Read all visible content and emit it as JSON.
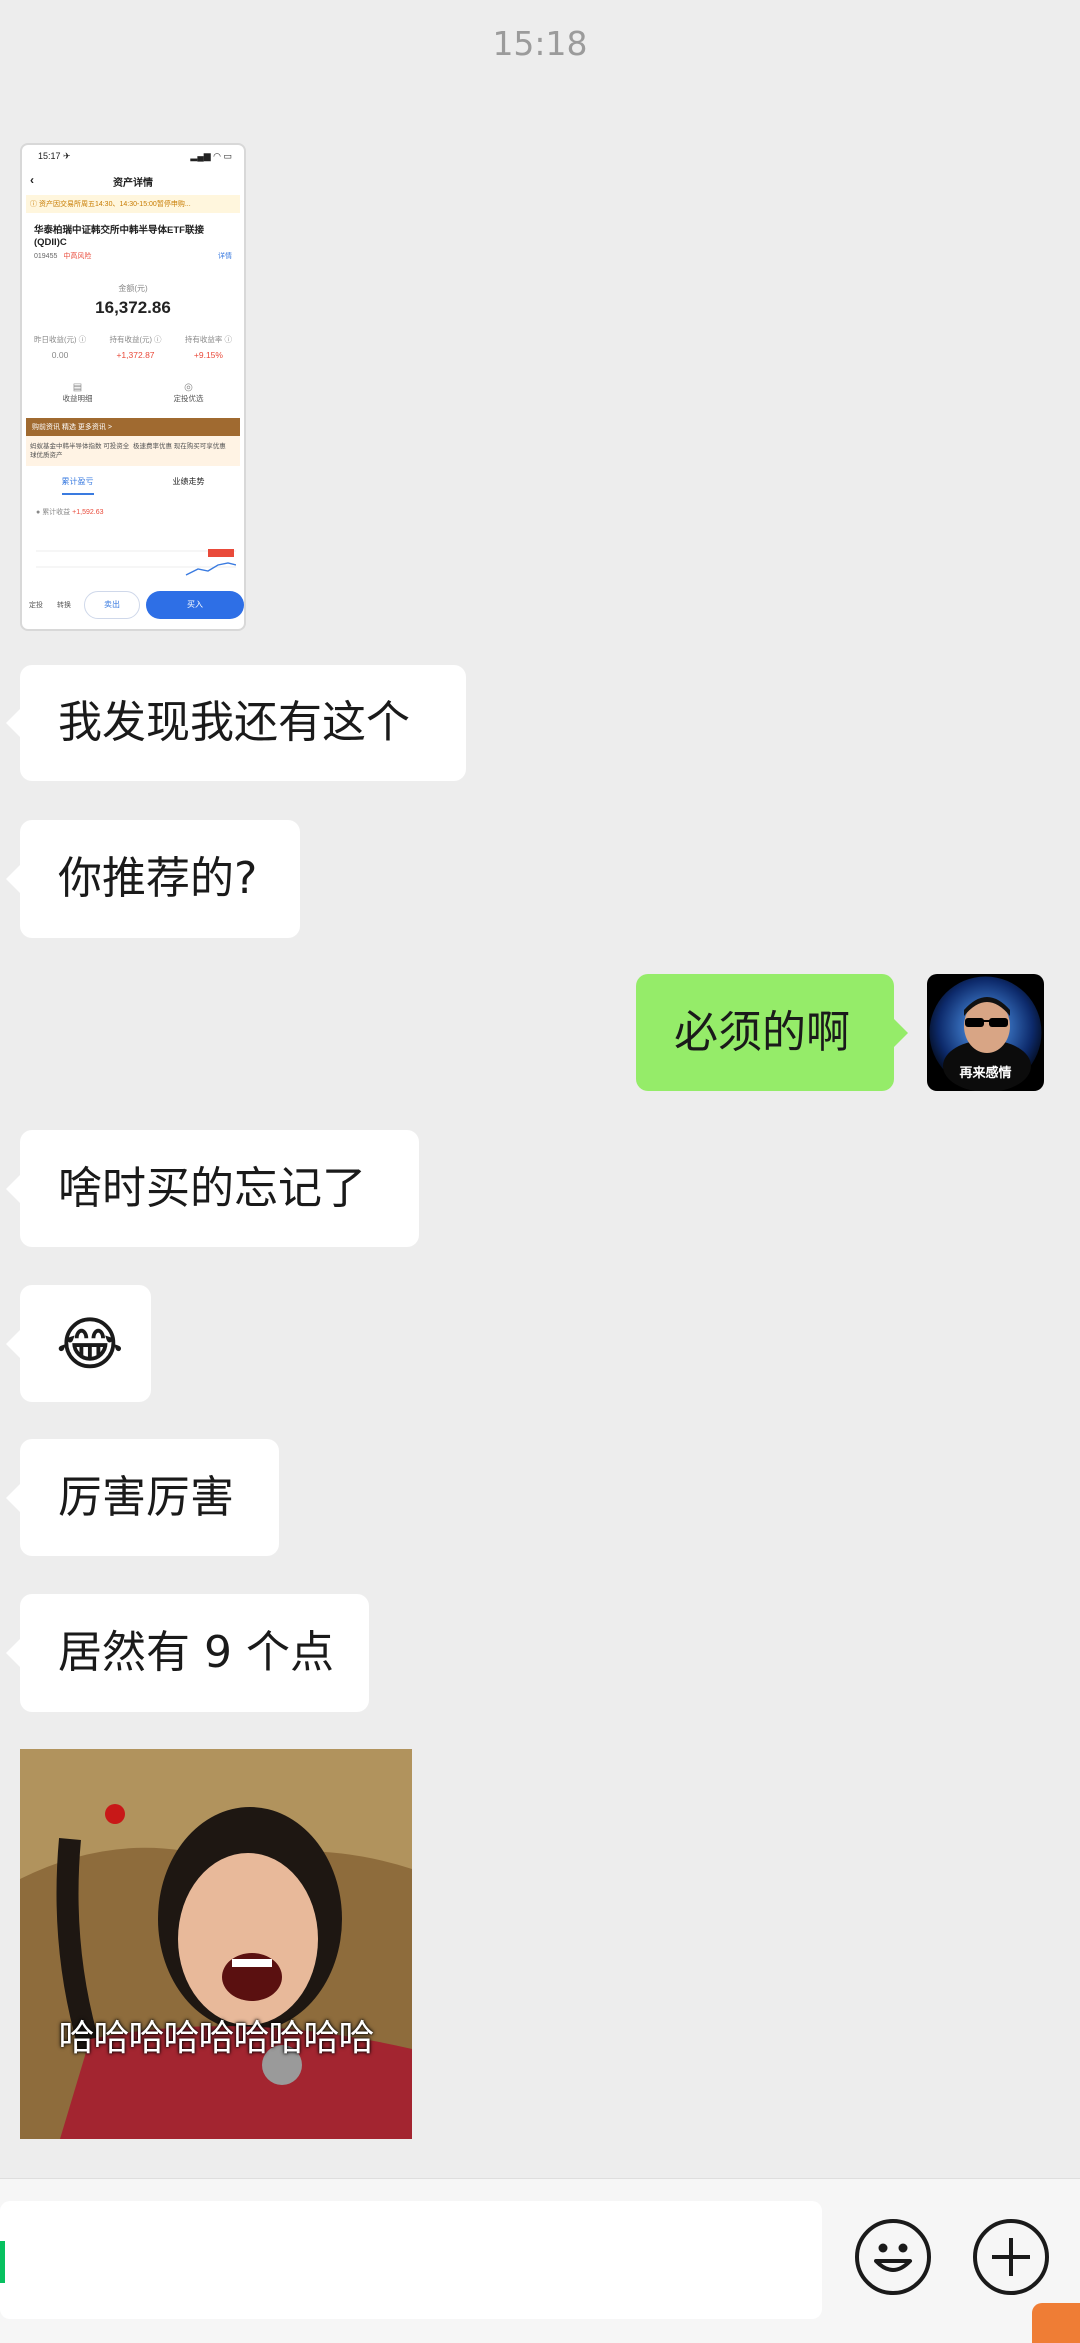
{
  "time_divider": "15:18",
  "screenshot_card": {
    "status_time": "15:17 ✈",
    "status_icons": "▂▄▆ ◠ ▭",
    "page_title": "资产详情",
    "notice": "ⓘ 资产因交易所周五14:30、14:30-15:00暂停申购...",
    "fund_name": "华泰柏瑞中证韩交所中韩半导体ETF联接(QDII)C",
    "fund_code": "019455",
    "fund_tag": "中高风险",
    "more_link": "详情",
    "amount_label": "金额(元)",
    "amount": "16,372.86",
    "stats": [
      {
        "label": "昨日收益(元) ⓘ",
        "value": "0.00",
        "red": false
      },
      {
        "label": "持有收益(元) ⓘ",
        "value": "+1,372.87",
        "red": true
      },
      {
        "label": "持有收益率 ⓘ",
        "value": "+9.15%",
        "red": true
      }
    ],
    "actions": [
      {
        "icon": "▤",
        "label": "收益明细"
      },
      {
        "icon": "◎",
        "label": "定投优选"
      }
    ],
    "banner": "购前资讯 精选 更多资讯 >",
    "promo_left": "蚂蚁基金中韩半导体指数 可投资全球优质资产",
    "promo_right": "极速费率优惠 现在购买可享优惠",
    "tab_active": "累计盈亏",
    "tab_other": "业绩走势",
    "profit_label": "累计收益",
    "profit_value": "+1,592.63",
    "bottom_left1": "定投",
    "bottom_left2": "转换",
    "sell_label": "卖出",
    "buy_label": "买入"
  },
  "messages": [
    {
      "side": "left",
      "text": "我发现我还有这个"
    },
    {
      "side": "left",
      "text": "你推荐的?"
    },
    {
      "side": "right",
      "text": "必须的啊"
    },
    {
      "side": "left",
      "text": "啥时买的忘记了"
    },
    {
      "side": "left",
      "text": "😂"
    },
    {
      "side": "left",
      "text": "厉害厉害"
    },
    {
      "side": "left",
      "text": "居然有 9 个点"
    }
  ],
  "avatar_caption": "再来感情",
  "sticker_caption": "哈哈哈哈哈哈哈哈哈",
  "input_bar": {
    "emoji_icon": "smiley-face-icon",
    "plus_icon": "plus-circle-icon"
  },
  "colors": {
    "chat_bg": "#ededed",
    "left_bubble": "#ffffff",
    "right_bubble": "#95ec69",
    "cursor": "#07c160"
  }
}
